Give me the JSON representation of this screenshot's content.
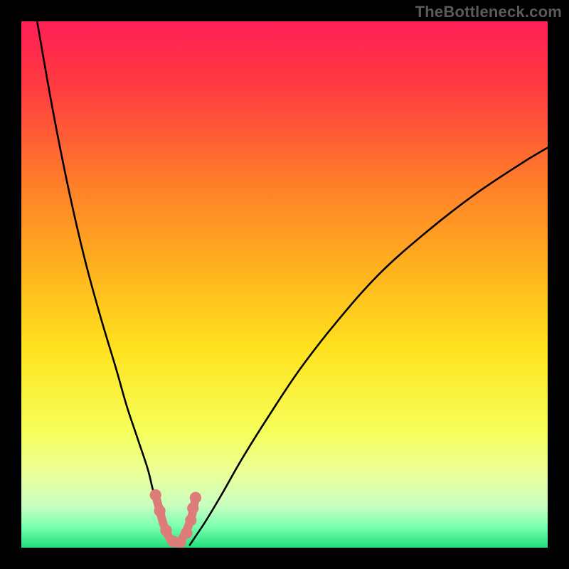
{
  "watermark": "TheBottleneck.com",
  "chart_data": {
    "type": "line",
    "title": "",
    "xlabel": "",
    "ylabel": "",
    "xlim": [
      0,
      100
    ],
    "ylim": [
      0,
      100
    ],
    "grid": false,
    "legend": false,
    "background_gradient": {
      "stops": [
        {
          "pct": 0,
          "color": "#ff1f56"
        },
        {
          "pct": 12,
          "color": "#ff3a40"
        },
        {
          "pct": 30,
          "color": "#ff7b2a"
        },
        {
          "pct": 48,
          "color": "#ffb51e"
        },
        {
          "pct": 62,
          "color": "#ffe21e"
        },
        {
          "pct": 78,
          "color": "#f6ff5a"
        },
        {
          "pct": 86,
          "color": "#eaff9a"
        },
        {
          "pct": 92,
          "color": "#c9ffc0"
        },
        {
          "pct": 96,
          "color": "#7affb0"
        },
        {
          "pct": 100,
          "color": "#22e07a"
        }
      ]
    },
    "series": [
      {
        "name": "curve-left",
        "stroke": "#000000",
        "x": [
          3,
          6,
          9,
          12,
          15,
          18,
          20,
          22,
          24,
          25,
          26,
          27,
          27.8,
          28.5
        ],
        "y": [
          100,
          83,
          68,
          55,
          44,
          34,
          27,
          21,
          15,
          11,
          8,
          5,
          2.5,
          0.5
        ]
      },
      {
        "name": "curve-right",
        "stroke": "#000000",
        "x": [
          32,
          33,
          35,
          38,
          42,
          47,
          53,
          60,
          68,
          77,
          86,
          95,
          100
        ],
        "y": [
          0.5,
          2,
          5,
          10,
          17,
          25,
          34,
          43,
          52,
          60,
          67,
          73,
          76
        ]
      },
      {
        "name": "marker-path",
        "stroke": "#de7c7a",
        "x": [
          25.5,
          26.3,
          27.0,
          27.8,
          28.5,
          29.3,
          30.1,
          30.9,
          31.7,
          32.5,
          33.1
        ],
        "y": [
          10.0,
          7.0,
          4.5,
          2.5,
          1.3,
          0.9,
          1.2,
          2.3,
          4.0,
          6.5,
          9.5
        ]
      }
    ],
    "markers": {
      "name": "highlight-dots",
      "fill": "#de7c7a",
      "r_pct": 1.1,
      "points": [
        {
          "x": 25.5,
          "y": 10.0
        },
        {
          "x": 26.3,
          "y": 7.0
        },
        {
          "x": 27.5,
          "y": 3.3
        },
        {
          "x": 28.8,
          "y": 1.2
        },
        {
          "x": 30.2,
          "y": 1.0
        },
        {
          "x": 31.4,
          "y": 2.8
        },
        {
          "x": 32.2,
          "y": 5.2
        },
        {
          "x": 32.6,
          "y": 7.5
        },
        {
          "x": 33.1,
          "y": 9.5
        }
      ]
    }
  }
}
